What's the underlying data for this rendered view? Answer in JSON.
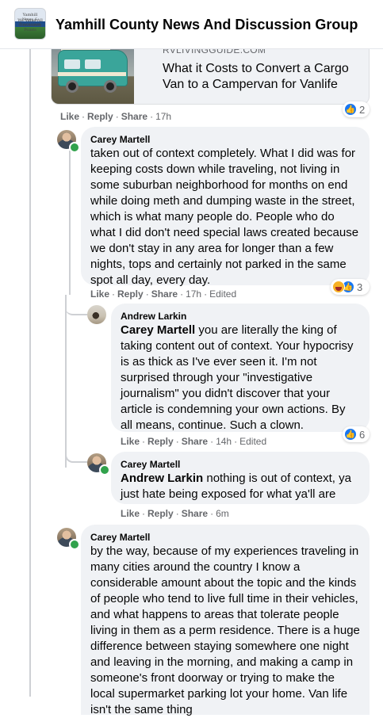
{
  "header": {
    "group_title": "Yamhill County News And Discussion Group",
    "thumb_line1": "Yamhill News & Discussion",
    "thumb_line2": "We Value All Community Points"
  },
  "link_preview": {
    "domain": "RVLIVINGGUIDE.COM",
    "title": "What it Costs to Convert a Cargo Van to a Campervan for Vanlife",
    "reaction_count": "2"
  },
  "top_actions": {
    "like": "Like",
    "reply": "Reply",
    "share": "Share",
    "time": "17h"
  },
  "comments": [
    {
      "author": "Carey Martell",
      "text": "taken out of context completely. What I did was for keeping costs down while traveling, not living in some suburban neighborhood for months on end while doing meth and dumping waste in the street, which is what many people do. People who do what I did don't need special laws created because we don't stay in any area for longer than a few nights, tops and certainly not parked in the same spot all day, every day.",
      "like": "Like",
      "reply": "Reply",
      "share": "Share",
      "time": "17h",
      "edited": "Edited",
      "reaction_count": "3"
    },
    {
      "author": "Andrew Larkin",
      "mention": "Carey Martell",
      "text": " you are literally the king of taking content out of context. Your hypocrisy is as thick as I've ever seen it. I'm not surprised through your \"investigative journalism\" you didn't discover that your article is condemning your own actions. By all means, continue. Such a clown.",
      "like": "Like",
      "reply": "Reply",
      "share": "Share",
      "time": "14h",
      "edited": "Edited",
      "reaction_count": "6"
    },
    {
      "author": "Carey Martell",
      "mention": "Andrew Larkin",
      "text": " nothing is out of context, ya just hate being exposed for what ya'll are",
      "like": "Like",
      "reply": "Reply",
      "share": "Share",
      "time": "6m"
    },
    {
      "author": "Carey Martell",
      "text": "by the way, because of my experiences traveling in many cities around the country I know a considerable amount about the topic and the kinds of people who tend to live full time in their vehicles, and what happens to areas that tolerate people living in them as a perm residence. There is a huge difference between staying somewhere one night and leaving in the morning, and making a camp in someone's front doorway or trying to make the local supermarket parking lot your home. Van life isn't the same thing"
    }
  ],
  "colors": {
    "accent": "#1877f2",
    "bubble": "#f0f2f5",
    "meta_text": "#65676b",
    "online": "#31a24c"
  },
  "icons": [
    "like-icon",
    "haha-icon",
    "online-dot"
  ]
}
